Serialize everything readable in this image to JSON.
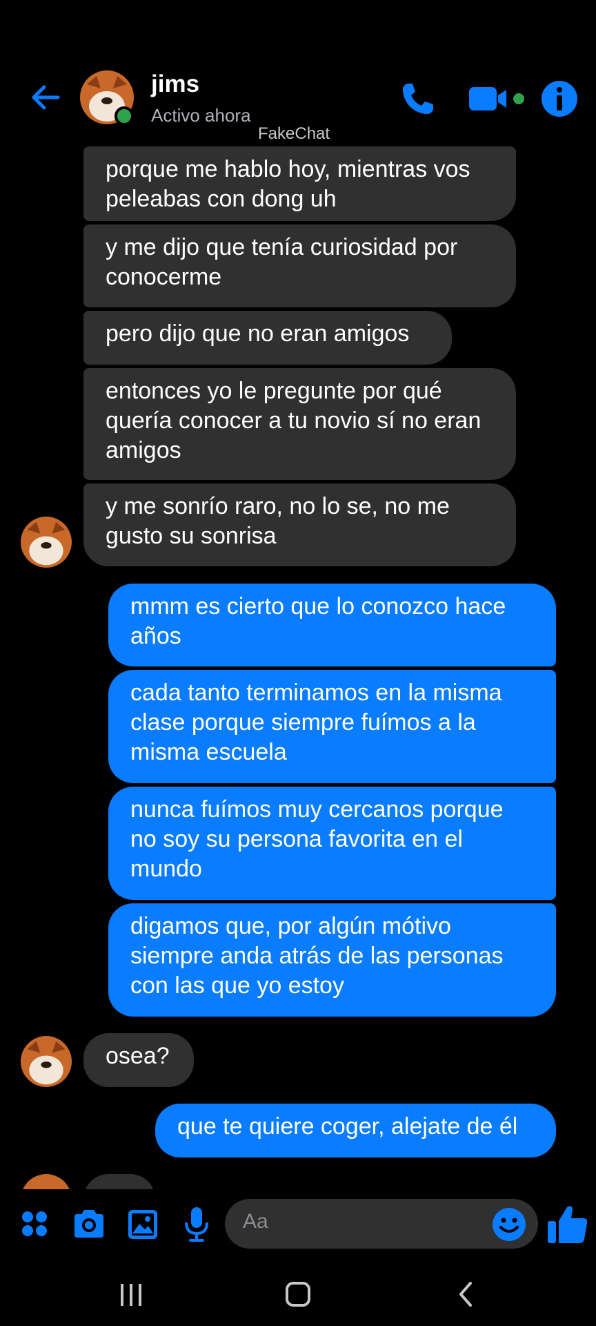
{
  "header": {
    "contact_name": "jims",
    "status": "Activo ahora",
    "watermark": "FakeChat",
    "back_icon": "arrow-left-icon",
    "call_icon": "phone-icon",
    "video_icon": "video-camera-icon",
    "info_icon": "info-icon"
  },
  "colors": {
    "accent": "#0a7cff",
    "incoming_bubble": "#303030",
    "online": "#31a24c",
    "background": "#000000"
  },
  "messages": [
    {
      "direction": "in",
      "text": "porque me hablo hoy, mientras vos peleabas con dong uh"
    },
    {
      "direction": "in",
      "text": "y me dijo que tenía curiosidad por conocerme"
    },
    {
      "direction": "in",
      "text": "pero dijo que no eran amigos"
    },
    {
      "direction": "in",
      "text": "entonces yo le pregunte por qué quería conocer a tu novio sí no eran amigos"
    },
    {
      "direction": "in",
      "text": "y me sonrío raro, no lo se, no me gusto su sonrisa"
    },
    {
      "direction": "out",
      "text": "mmm es cierto que lo conozco hace años"
    },
    {
      "direction": "out",
      "text": "cada tanto terminamos en la misma clase porque siempre fuímos a la misma escuela"
    },
    {
      "direction": "out",
      "text": "nunca fuímos muy cercanos porque no soy su persona favorita en el mundo"
    },
    {
      "direction": "out",
      "text": "digamos que, por algún mótivo siempre anda atrás de las personas con las que yo estoy"
    },
    {
      "direction": "in",
      "text": "osea?"
    },
    {
      "direction": "out",
      "text": "que te quiere coger, alejate de él"
    }
  ],
  "composer": {
    "placeholder": "Aa",
    "icons": [
      "apps-grid-icon",
      "camera-icon",
      "gallery-icon",
      "microphone-icon",
      "emoji-icon",
      "thumbs-up-icon"
    ]
  },
  "navbar": {
    "icons": [
      "recent-apps-icon",
      "home-icon",
      "back-icon"
    ]
  }
}
